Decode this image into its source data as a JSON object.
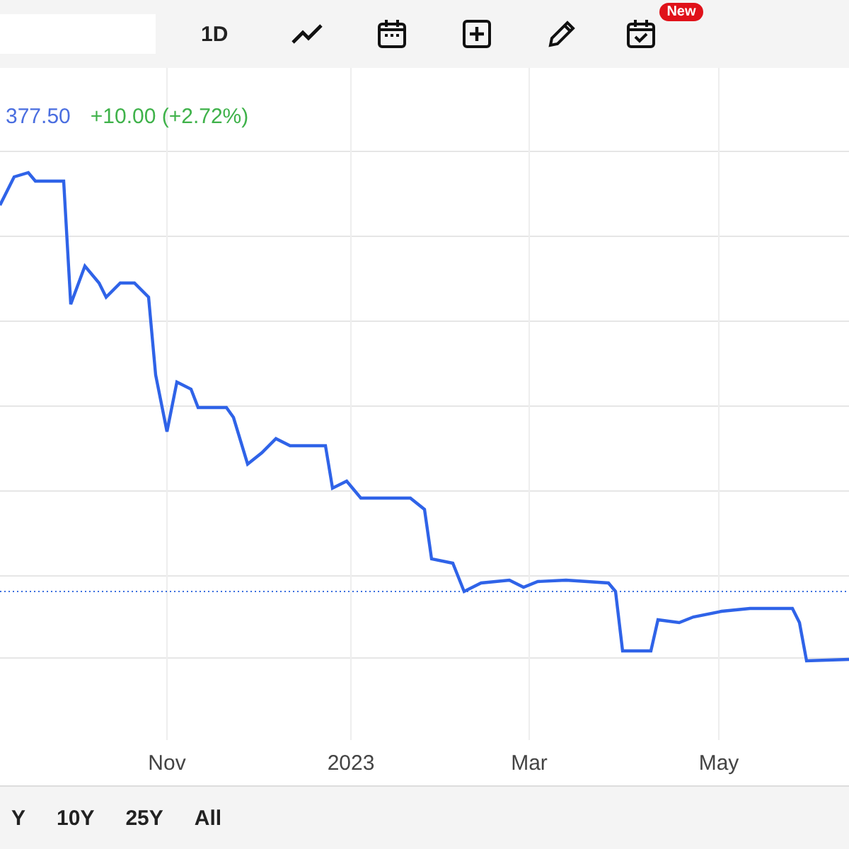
{
  "toolbar": {
    "interval": "1D",
    "badge": "New"
  },
  "quote": {
    "price": "377.50",
    "change": "+10.00 (+2.72%)"
  },
  "chart": {
    "x_labels": [
      "Nov",
      "2023",
      "Mar",
      "May"
    ]
  },
  "ranges": [
    {
      "label": "Y",
      "selected": false
    },
    {
      "label": "10Y",
      "selected": false
    },
    {
      "label": "25Y",
      "selected": false
    },
    {
      "label": "All",
      "selected": false
    }
  ]
}
